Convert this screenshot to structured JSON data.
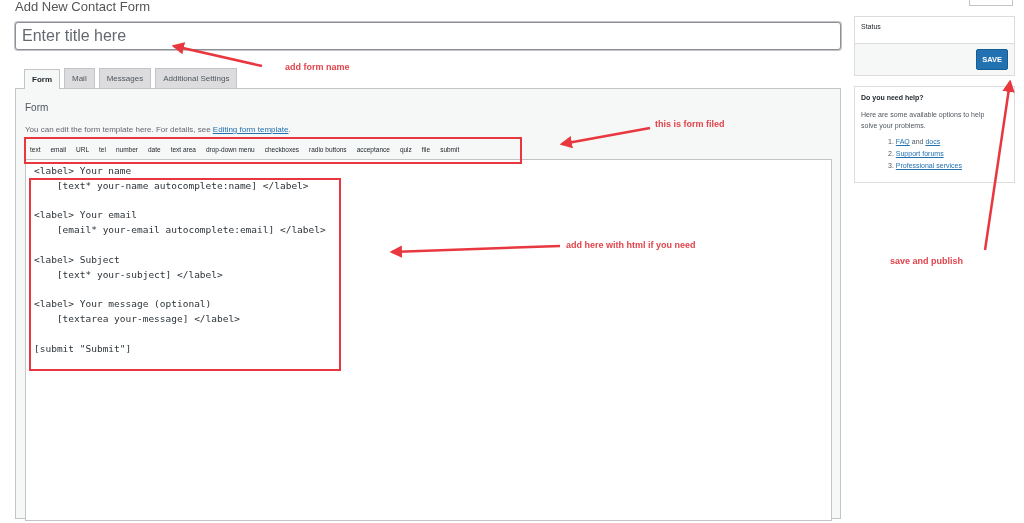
{
  "page_title": "Add New Contact Form",
  "title_field": {
    "placeholder": "Enter title here"
  },
  "tabs": [
    {
      "label": "Form",
      "selected": true
    },
    {
      "label": "Mail",
      "selected": false
    },
    {
      "label": "Messages",
      "selected": false
    },
    {
      "label": "Additional Settings",
      "selected": false
    }
  ],
  "panel": {
    "heading": "Form",
    "description": "You can edit the form template here. For details, see ",
    "link": "Editing form template",
    "description_end": ".",
    "tag_buttons": [
      "text",
      "email",
      "URL",
      "tel",
      "number",
      "date",
      "text area",
      "drop-down menu",
      "checkboxes",
      "radio buttons",
      "acceptance",
      "quiz",
      "file",
      "submit"
    ],
    "editor": {
      "value": "<label> Your name\n    [text* your-name autocomplete:name] </label>\n\n<label> Your email\n    [email* your-email autocomplete:email] </label>\n\n<label> Subject\n    [text* your-subject] </label>\n\n<label> Your message (optional)\n    [textarea your-message] </label>\n\n[submit \"Submit\"]"
    }
  },
  "status_box": {
    "title": "Status",
    "button": "SAVE"
  },
  "help_box": {
    "title": "Do you need help?",
    "text": "Here are some available options to help solve your problems.",
    "items": [
      {
        "number": "1.",
        "parts": [
          {
            "text": "FAQ",
            "link": true
          },
          {
            "text": " and ",
            "link": false
          },
          {
            "text": "docs",
            "link": true
          }
        ]
      },
      {
        "number": "2.",
        "parts": [
          {
            "text": "Support forums",
            "link": true
          }
        ]
      },
      {
        "number": "3.",
        "parts": [
          {
            "text": "Professional services",
            "link": true
          }
        ]
      }
    ]
  },
  "annotations": [
    {
      "text": "add form name"
    },
    {
      "text": "this is form filed"
    },
    {
      "text": "add here with html if you need"
    },
    {
      "text": "save and publish"
    }
  ]
}
